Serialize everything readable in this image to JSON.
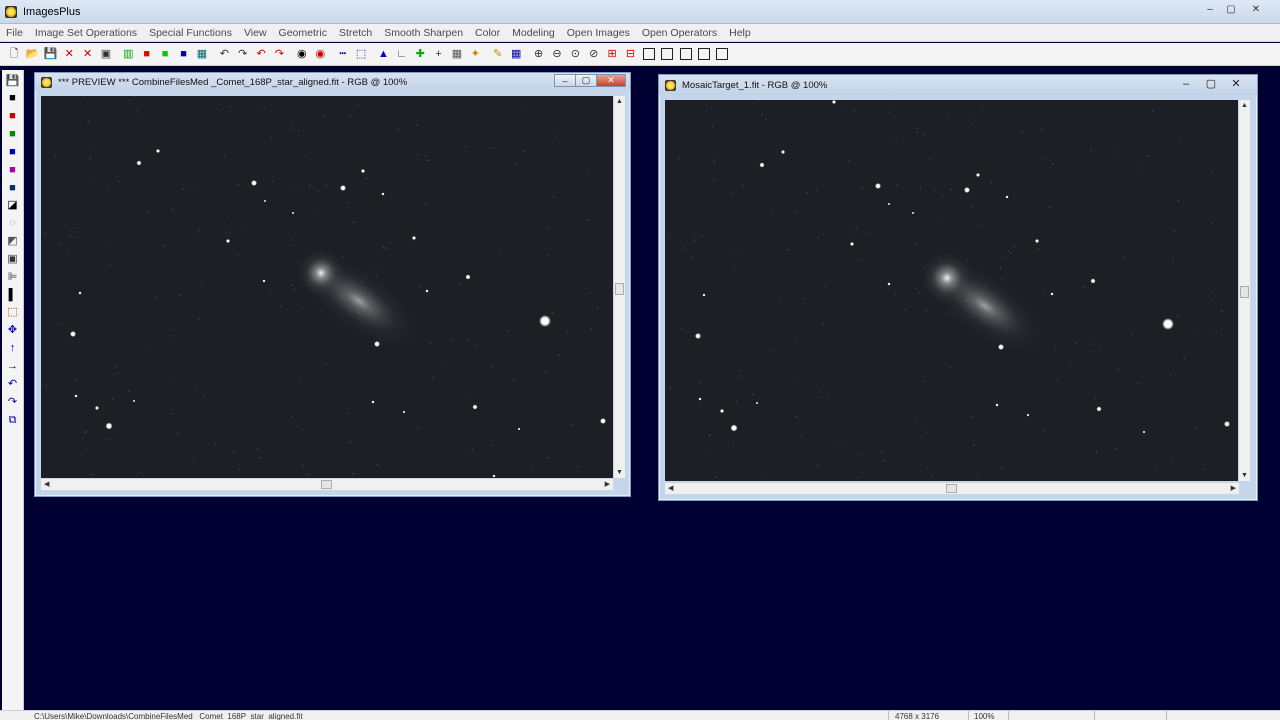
{
  "app": {
    "title": "ImagesPlus",
    "window_controls": [
      "–",
      "▢",
      "✕"
    ]
  },
  "menu": [
    "File",
    "Image Set Operations",
    "Special Functions",
    "View",
    "Geometric",
    "Stretch",
    "Smooth Sharpen",
    "Color",
    "Modeling",
    "Open Images",
    "Open Operators",
    "Help"
  ],
  "toolbar": {
    "icons": [
      "new-file-icon",
      "open-file-icon",
      "save-icon",
      "delete-icon",
      "close-x-icon",
      "copy-icon",
      "rgb-channels-icon",
      "red-channel-icon",
      "green-channel-icon",
      "blue-channel-icon",
      "grid-icon",
      "undo-icon",
      "redo-icon",
      "undo-red-icon",
      "redo-red-icon",
      "target-icon",
      "target-red-icon",
      "dashes-icon",
      "crop-icon",
      "histogram-icon",
      "axis-icon",
      "crosshair-green-icon",
      "crosshair-icon",
      "grid-small-icon",
      "star-icon",
      "pencil-icon",
      "grid-blue-icon",
      "zoom-in-icon",
      "zoom-out-icon",
      "zoom-fit-icon",
      "zoom-actual-icon",
      "add-red-icon",
      "subtract-icon",
      "square-1-icon",
      "square-2-icon",
      "square-3-icon",
      "square-4-icon",
      "square-5-icon"
    ],
    "glyphs": [
      "🗋",
      "📂",
      "💾",
      "✕",
      "✕",
      "▣",
      "▥",
      "■",
      "■",
      "■",
      "▦",
      "↶",
      "↷",
      "↶",
      "↷",
      "◉",
      "◉",
      "┅",
      "⬚",
      "▲",
      "∟",
      "✚",
      "+",
      "▦",
      "✦",
      "✎",
      "▦",
      "⊕",
      "⊖",
      "⊙",
      "⊘",
      "⊞",
      "⊟",
      "□",
      "□",
      "□",
      "□",
      "□"
    ],
    "colors": [
      "#222",
      "#b88a00",
      "#222",
      "#c00",
      "#c00",
      "#333",
      "#0a0",
      "#e00",
      "#0c0",
      "#00c",
      "#066",
      "#333",
      "#333",
      "#c00",
      "#c00",
      "#000",
      "#c00",
      "#00c",
      "#00c",
      "#00c",
      "#555",
      "#0a0",
      "#333",
      "#555",
      "#c80",
      "#c80",
      "#00a",
      "#333",
      "#333",
      "#333",
      "#333",
      "#c00",
      "#c00",
      "#111",
      "#111",
      "#111",
      "#111",
      "#111"
    ]
  },
  "left_toolbar": {
    "icons": [
      "save-icon",
      "black-square-icon",
      "red-square-icon",
      "green-square-icon",
      "blue-square-icon",
      "dual-tone-icon",
      "dual-tone-blue-icon",
      "corner-icon",
      "contrast-icon",
      "gradient-icon",
      "frame-icon",
      "bars-icon",
      "black-white-icon",
      "select-region-icon",
      "move-icon",
      "arrow-up-icon",
      "arrow-right-icon",
      "rotate-left-icon",
      "rotate-right-icon",
      "duplicate-icon"
    ],
    "glyphs": [
      "💾",
      "■",
      "■",
      "■",
      "■",
      "■",
      "■",
      "◪",
      "◌",
      "◩",
      "▣",
      "⊫",
      "▌",
      "⬚",
      "✥",
      "↑",
      "→",
      "↶",
      "↷",
      "⧉"
    ],
    "colors": [
      "#222",
      "#000",
      "#c00",
      "#080",
      "#00a",
      "#a0a",
      "#036",
      "#000",
      "#777",
      "#555",
      "#333",
      "#333",
      "#000",
      "#c00",
      "#00a",
      "#00a",
      "#00a",
      "#00a",
      "#00a",
      "#00a"
    ]
  },
  "windows": [
    {
      "title": "*** PREVIEW *** CombineFilesMed _Comet_168P_star_aligned.fit - RGB @ 100%",
      "stars": [
        [
          138,
          162,
          2.5
        ],
        [
          157,
          150,
          2
        ],
        [
          253,
          182,
          3
        ],
        [
          342,
          187,
          3
        ],
        [
          362,
          170,
          2
        ],
        [
          382,
          193,
          1.5
        ],
        [
          227,
          240,
          2
        ],
        [
          413,
          237,
          2
        ],
        [
          467,
          276,
          2.5
        ],
        [
          72,
          333,
          3
        ],
        [
          108,
          425,
          3.5
        ],
        [
          96,
          407,
          2
        ],
        [
          544,
          320,
          6
        ],
        [
          376,
          343,
          3
        ],
        [
          474,
          406,
          2.5
        ],
        [
          602,
          420,
          3
        ],
        [
          263,
          280,
          1.5
        ],
        [
          426,
          290,
          1.5
        ],
        [
          79,
          292,
          1.5
        ],
        [
          292,
          212,
          1.2
        ],
        [
          264,
          200,
          1.2
        ],
        [
          372,
          401,
          1.5
        ],
        [
          403,
          411,
          1.3
        ],
        [
          518,
          428,
          1.3
        ],
        [
          75,
          395,
          1.5
        ],
        [
          133,
          400,
          1.2
        ],
        [
          493,
          475,
          1.5
        ]
      ],
      "comet": [
        320,
        272,
        24
      ]
    },
    {
      "title": "MosaicTarget_1.fit - RGB @ 100%",
      "stars": [
        [
          761,
          164,
          2.5
        ],
        [
          782,
          151,
          2
        ],
        [
          877,
          185,
          3
        ],
        [
          966,
          189,
          3
        ],
        [
          977,
          174,
          2
        ],
        [
          1006,
          196,
          1.5
        ],
        [
          851,
          243,
          2
        ],
        [
          1036,
          240,
          2
        ],
        [
          1092,
          280,
          2.5
        ],
        [
          697,
          335,
          3
        ],
        [
          733,
          427,
          3.5
        ],
        [
          721,
          410,
          2
        ],
        [
          1167,
          323,
          6
        ],
        [
          1000,
          346,
          3
        ],
        [
          1098,
          408,
          2.5
        ],
        [
          1226,
          423,
          3
        ],
        [
          888,
          283,
          1.5
        ],
        [
          1051,
          293,
          1.5
        ],
        [
          703,
          294,
          1.5
        ],
        [
          912,
          212,
          1.2
        ],
        [
          888,
          203,
          1.2
        ],
        [
          996,
          404,
          1.5
        ],
        [
          1027,
          414,
          1.3
        ],
        [
          1143,
          431,
          1.3
        ],
        [
          699,
          398,
          1.5
        ],
        [
          756,
          402,
          1.2
        ],
        [
          833,
          101,
          2
        ]
      ],
      "comet": [
        946,
        277,
        26
      ]
    }
  ],
  "status": {
    "path": "C:\\Users\\Mike\\Downloads\\CombineFilesMed _Comet_168P_star_aligned.fit",
    "dims": "4768 x 3176",
    "zoom": "100%"
  }
}
